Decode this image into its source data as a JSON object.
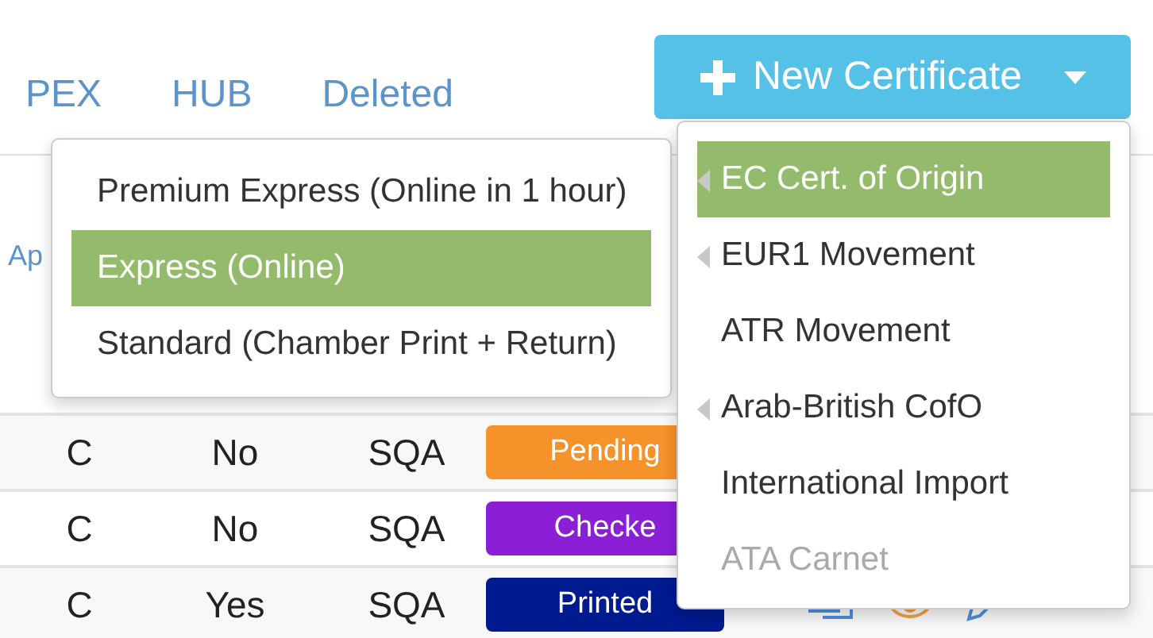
{
  "tabs": [
    {
      "label": "PEX"
    },
    {
      "label": "HUB"
    },
    {
      "label": "Deleted"
    }
  ],
  "new_certificate_button": {
    "label": "New Certificate"
  },
  "link": "Ap",
  "table": {
    "rows": [
      {
        "cells": [
          "C",
          "No",
          "SQA"
        ],
        "status": {
          "label": "Pending",
          "color": "#f5922a"
        }
      },
      {
        "cells": [
          "C",
          "No",
          "SQA"
        ],
        "status": {
          "label": "Checke",
          "color": "#8b1fd6"
        }
      },
      {
        "cells": [
          "C",
          "Yes",
          "SQA"
        ],
        "status": {
          "label": "Printed",
          "color": "#001a8f"
        },
        "actions": true
      }
    ]
  },
  "service_menu": {
    "items": [
      {
        "label": "Premium Express (Online in 1 hour)",
        "selected": false
      },
      {
        "label": "Express (Online)",
        "selected": true
      },
      {
        "label": "Standard (Chamber Print + Return)",
        "selected": false
      }
    ]
  },
  "certificate_menu": {
    "items": [
      {
        "label": "EC Cert. of Origin",
        "selected": true,
        "has_submenu": true,
        "disabled": false
      },
      {
        "label": "EUR1 Movement",
        "selected": false,
        "has_submenu": true,
        "disabled": false
      },
      {
        "label": "ATR Movement",
        "selected": false,
        "has_submenu": false,
        "disabled": false
      },
      {
        "label": "Arab-British CofO",
        "selected": false,
        "has_submenu": true,
        "disabled": false
      },
      {
        "label": "International Import",
        "selected": false,
        "has_submenu": false,
        "disabled": false
      },
      {
        "label": "ATA Carnet",
        "selected": false,
        "has_submenu": false,
        "disabled": true
      }
    ]
  }
}
